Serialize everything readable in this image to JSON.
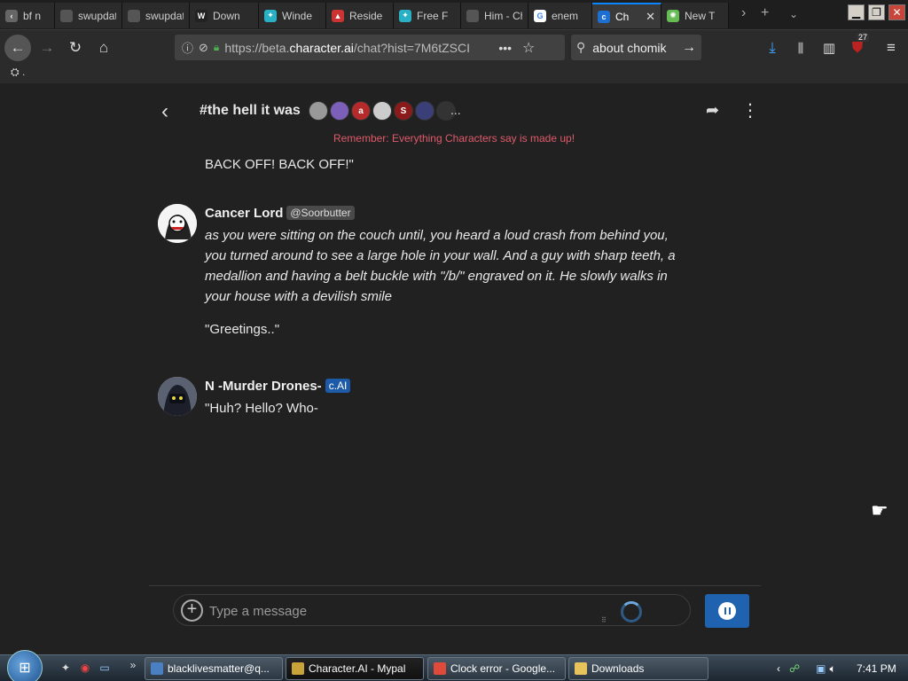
{
  "browser": {
    "tabs": [
      {
        "label": "bf n",
        "color": "#666",
        "glyph": "‹"
      },
      {
        "label": "swupdate",
        "color": "#555",
        "glyph": ""
      },
      {
        "label": "swupdate",
        "color": "#555",
        "glyph": ""
      },
      {
        "label": "Down",
        "color": "#222",
        "glyph": "W"
      },
      {
        "label": "Winde",
        "color": "#2ab0c5",
        "glyph": "✦"
      },
      {
        "label": "Reside",
        "color": "#c33",
        "glyph": "▲"
      },
      {
        "label": "Free F",
        "color": "#2ab0c5",
        "glyph": "✦"
      },
      {
        "label": "Him - Cha",
        "color": "#555",
        "glyph": ""
      },
      {
        "label": "enem",
        "color": "#fff",
        "glyph": "G"
      },
      {
        "label": "Ch",
        "color": "#1d6fd1",
        "glyph": "c"
      },
      {
        "label": "New T",
        "color": "#6b5",
        "glyph": "✺"
      }
    ],
    "active_tab_close": "✕",
    "url_prefix": "https://beta.",
    "url_domain": "character.ai",
    "url_rest": "/chat?hist=7M6tZSCI",
    "url_dots": "•••",
    "search_value": "about chomik",
    "addon_badge": "27",
    "bookmark_label": "."
  },
  "chat": {
    "title": "#the hell it was",
    "more": "...",
    "participants": [
      {
        "initial": "",
        "color": "#999"
      },
      {
        "initial": "",
        "color": "#7b5fb8"
      },
      {
        "initial": "a",
        "color": "#b52a2a"
      },
      {
        "initial": "",
        "color": "#ccc"
      },
      {
        "initial": "S",
        "color": "#8b1a1a"
      },
      {
        "initial": "",
        "color": "#3a3f78"
      },
      {
        "initial": "",
        "color": "#333"
      }
    ],
    "disclaimer": "Remember: Everything Characters say is made up!",
    "prev_tail": "BACK OFF! BACK OFF!\"",
    "messages": [
      {
        "author": "Cancer Lord",
        "tag": "@Soorbutter",
        "paragraphs": [
          "as you were sitting on the couch until, you heard a loud crash from behind you, you turned around to see a large hole in your wall. And a guy with sharp teeth, a medallion and having a belt buckle with \"/b/\" engraved on it. He slowly walks in your house with a devilish smile",
          "\"Greetings..\""
        ]
      },
      {
        "author": "N -Murder Drones-",
        "tag": "c.AI",
        "paragraphs": [
          "\"Huh? Hello? Who-"
        ]
      }
    ],
    "composer_placeholder": "Type a message"
  },
  "taskbar": {
    "items": [
      {
        "label": "blacklivesmatter@q...",
        "color": "#4a7fc1"
      },
      {
        "label": "Character.AI - Mypal",
        "color": "#c9a23a"
      },
      {
        "label": "Clock error - Google...",
        "color": "#e04a3a"
      },
      {
        "label": "Downloads",
        "color": "#e8c25a"
      }
    ],
    "clock": "7:41 PM"
  },
  "colors": {
    "disclaimer": "#e05a6a",
    "ai_tag": "#1d5aa8",
    "send_button": "#1f63b0",
    "background": "#212121"
  }
}
